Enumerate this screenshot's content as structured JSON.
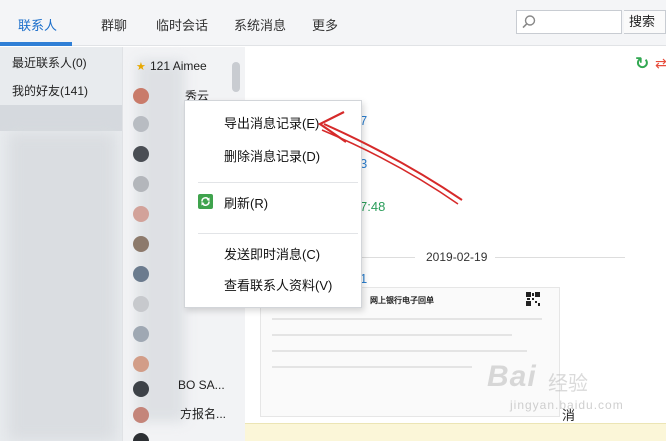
{
  "nav": {
    "tabs": [
      {
        "label": "联系人"
      },
      {
        "label": "群聊"
      },
      {
        "label": "临时会话"
      },
      {
        "label": "系统消息"
      },
      {
        "label": "更多"
      }
    ],
    "search_button": "搜索"
  },
  "categories": [
    {
      "label": "最近联系人(0)"
    },
    {
      "label": "我的好友(141)"
    }
  ],
  "contacts": [
    {
      "name": "121 Aimee"
    },
    {
      "name": "秀云"
    },
    {
      "name": "BO SA..."
    },
    {
      "name": "方报名..."
    }
  ],
  "chat": {
    "date_separator": "2019-02-19",
    "peek_1": "7",
    "peek_2": "3",
    "peek_3": "7:48",
    "peek_4": "1",
    "receipt_title": "网上银行电子回单",
    "cancel_text": "消"
  },
  "context_menu": {
    "items": [
      {
        "label": "导出消息记录(E)"
      },
      {
        "label": "删除消息记录(D)"
      },
      {
        "label": "刷新(R)"
      },
      {
        "label": "发送即时消息(C)"
      },
      {
        "label": "查看联系人资料(V)"
      }
    ]
  },
  "watermark": {
    "brand": "Bai",
    "sub": "经验",
    "url": "jingyan.baidu.com"
  },
  "colors": {
    "accent": "#1c6fcb",
    "annotation": "#d62a2a",
    "refresh_green": "#32a852"
  }
}
